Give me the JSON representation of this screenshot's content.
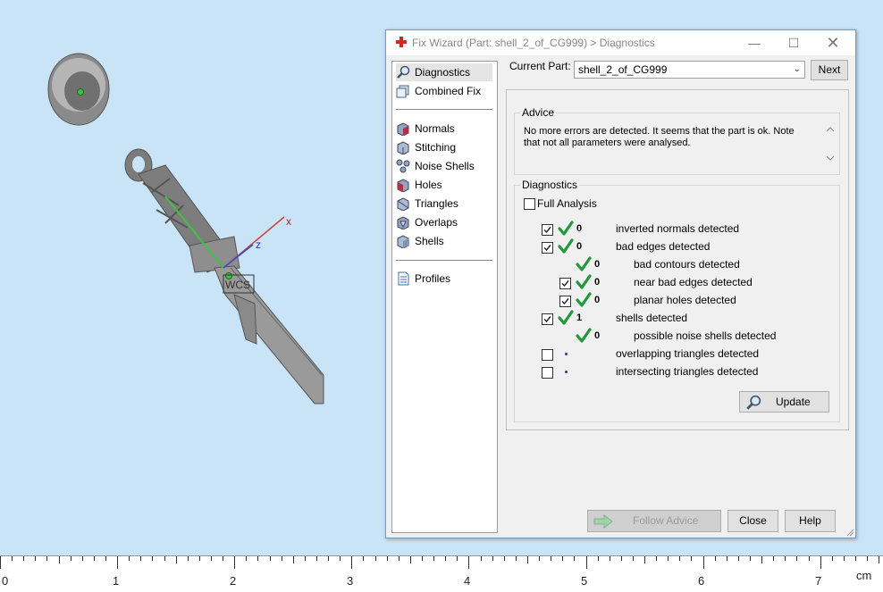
{
  "viewport": {
    "axis_x": "x",
    "axis_z": "z",
    "wcs_label": "WCS"
  },
  "ruler": {
    "labels": [
      "0",
      "1",
      "2",
      "3",
      "4",
      "5",
      "6",
      "7"
    ],
    "unit": "cm"
  },
  "dialog": {
    "title": "Fix Wizard (Part: shell_2_of_CG999) > Diagnostics",
    "current_part_label": "Current Part:",
    "current_part_value": "shell_2_of_CG999",
    "next_label": "Next",
    "nav": {
      "diagnostics": "Diagnostics",
      "combined_fix": "Combined Fix",
      "normals": "Normals",
      "stitching": "Stitching",
      "noise_shells": "Noise Shells",
      "holes": "Holes",
      "triangles": "Triangles",
      "overlaps": "Overlaps",
      "shells": "Shells",
      "profiles": "Profiles"
    },
    "advice": {
      "title": "Advice",
      "text": "No more errors are detected. It seems that the part is ok. Note that not all parameters were analysed."
    },
    "diagnostics": {
      "title": "Diagnostics",
      "full_analysis": "Full Analysis",
      "rows": [
        {
          "checked": true,
          "status": "ok",
          "count": "0",
          "label": "inverted normals detected"
        },
        {
          "checked": true,
          "status": "ok",
          "count": "0",
          "label": "bad edges detected"
        },
        {
          "checked": null,
          "status": "ok",
          "count": "0",
          "label": "bad contours detected"
        },
        {
          "checked": true,
          "status": "ok",
          "count": "0",
          "label": "near bad edges detected"
        },
        {
          "checked": true,
          "status": "ok",
          "count": "0",
          "label": "planar holes detected"
        },
        {
          "checked": true,
          "status": "ok",
          "count": "1",
          "label": "shells detected"
        },
        {
          "checked": null,
          "status": "ok",
          "count": "0",
          "label": "possible noise shells detected"
        },
        {
          "checked": false,
          "status": "pending",
          "count": "",
          "label": "overlapping triangles detected"
        },
        {
          "checked": false,
          "status": "pending",
          "count": "",
          "label": "intersecting triangles detected"
        }
      ],
      "update_label": "Update"
    },
    "footer": {
      "follow_advice": "Follow Advice",
      "close": "Close",
      "help": "Help"
    }
  }
}
